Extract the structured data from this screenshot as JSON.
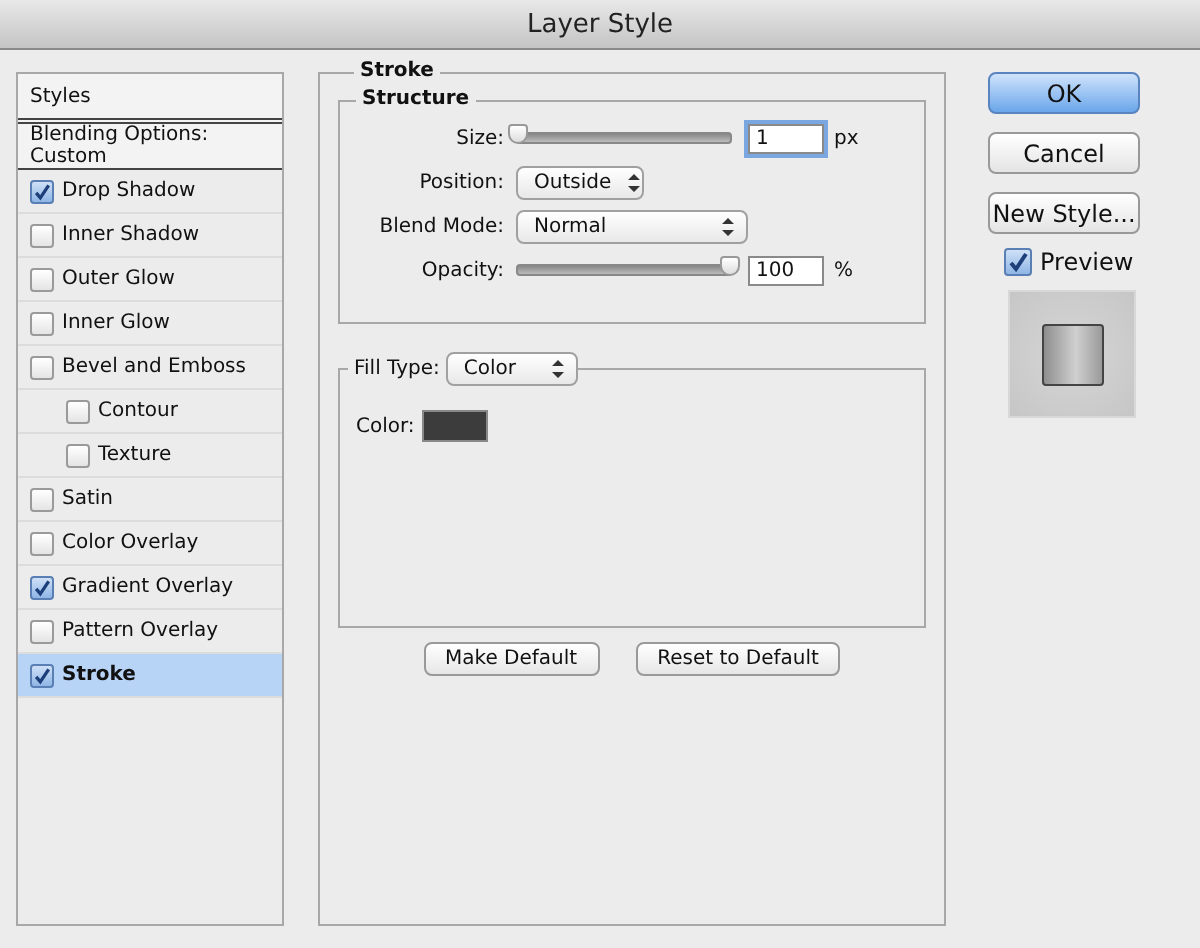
{
  "window": {
    "title": "Layer Style"
  },
  "styles_list": {
    "header": "Styles",
    "blending_options": "Blending Options: Custom",
    "items": [
      {
        "label": "Drop Shadow",
        "checked": true,
        "selected": false
      },
      {
        "label": "Inner Shadow",
        "checked": false,
        "selected": false
      },
      {
        "label": "Outer Glow",
        "checked": false,
        "selected": false
      },
      {
        "label": "Inner Glow",
        "checked": false,
        "selected": false
      },
      {
        "label": "Bevel and Emboss",
        "checked": false,
        "selected": false,
        "children": [
          {
            "label": "Contour",
            "checked": false,
            "selected": false
          },
          {
            "label": "Texture",
            "checked": false,
            "selected": false
          }
        ]
      },
      {
        "label": "Satin",
        "checked": false,
        "selected": false
      },
      {
        "label": "Color Overlay",
        "checked": false,
        "selected": false
      },
      {
        "label": "Gradient Overlay",
        "checked": true,
        "selected": false
      },
      {
        "label": "Pattern Overlay",
        "checked": false,
        "selected": false
      },
      {
        "label": "Stroke",
        "checked": true,
        "selected": true
      }
    ]
  },
  "stroke": {
    "title": "Stroke",
    "structure": {
      "title": "Structure",
      "size": {
        "label": "Size:",
        "level": 0,
        "value": "1",
        "unit": "px"
      },
      "position": {
        "label": "Position:",
        "value": "Outside"
      },
      "blend_mode": {
        "label": "Blend Mode:",
        "value": "Normal"
      },
      "opacity": {
        "label": "Opacity:",
        "level": 1,
        "value": "100",
        "unit": "%"
      }
    },
    "fill_type": {
      "label": "Fill Type:",
      "value": "Color"
    },
    "color": {
      "label": "Color:",
      "color": "#3c3c3c"
    },
    "buttons": [
      "Make Default",
      "Reset to Default"
    ]
  },
  "actions": {
    "buttons": [
      {
        "label": "OK",
        "kind": "default"
      },
      {
        "label": "Cancel",
        "kind": "normal"
      },
      {
        "label": "New Style...",
        "kind": "normal"
      }
    ],
    "preview": {
      "label": "Preview",
      "checked": true
    }
  }
}
